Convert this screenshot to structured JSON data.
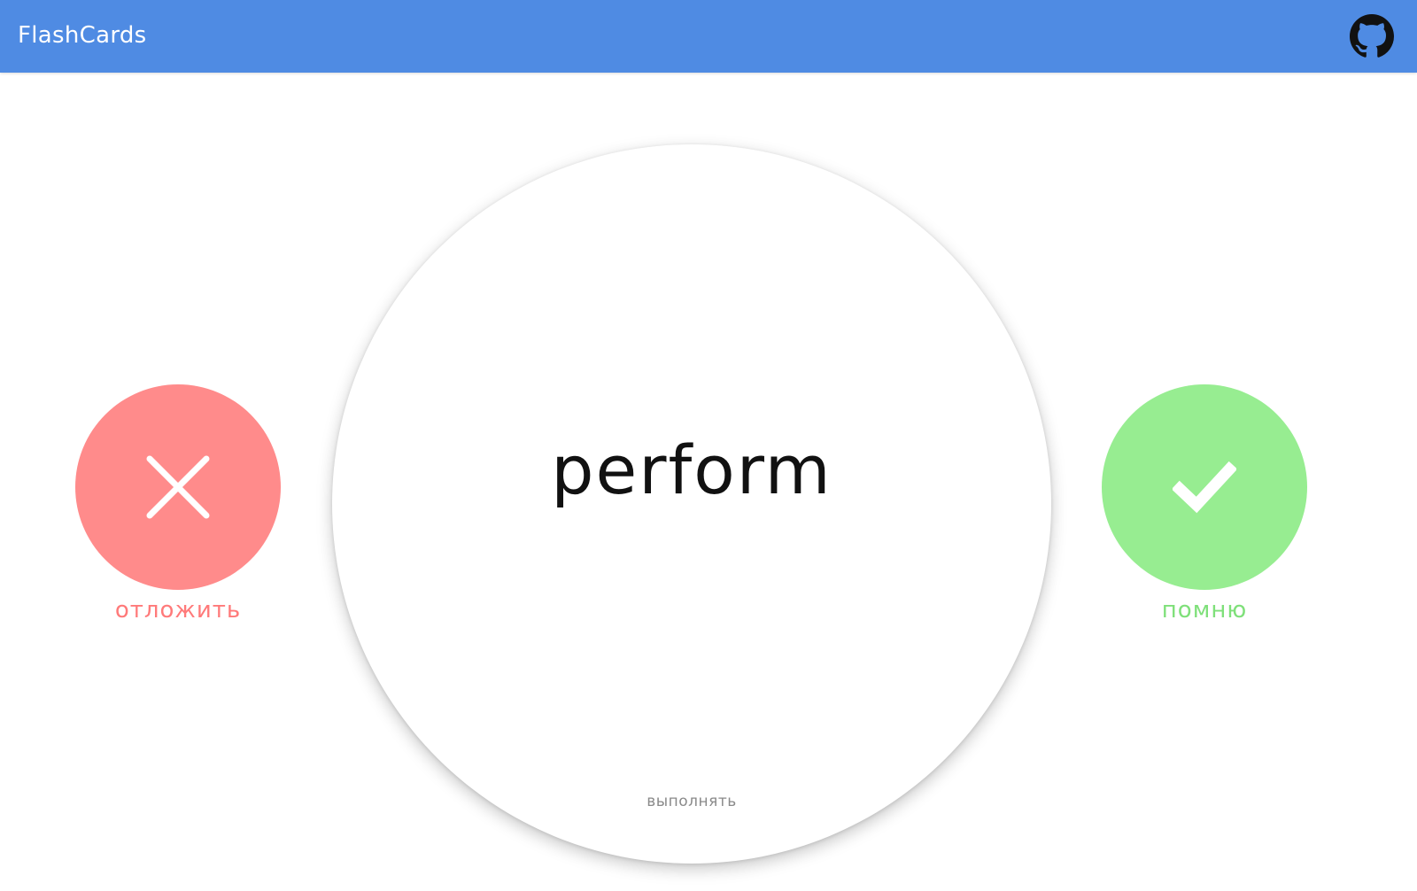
{
  "header": {
    "title": "FlashCards",
    "github_icon": "github-icon",
    "background_color": "#4f8be3"
  },
  "card": {
    "word": "perform",
    "translation": "выполнять"
  },
  "actions": {
    "postpone": {
      "label": "отложить",
      "icon": "close-icon",
      "color": "#ff8b8b"
    },
    "remember": {
      "label": "помню",
      "icon": "check-icon",
      "color": "#97ed91"
    }
  }
}
